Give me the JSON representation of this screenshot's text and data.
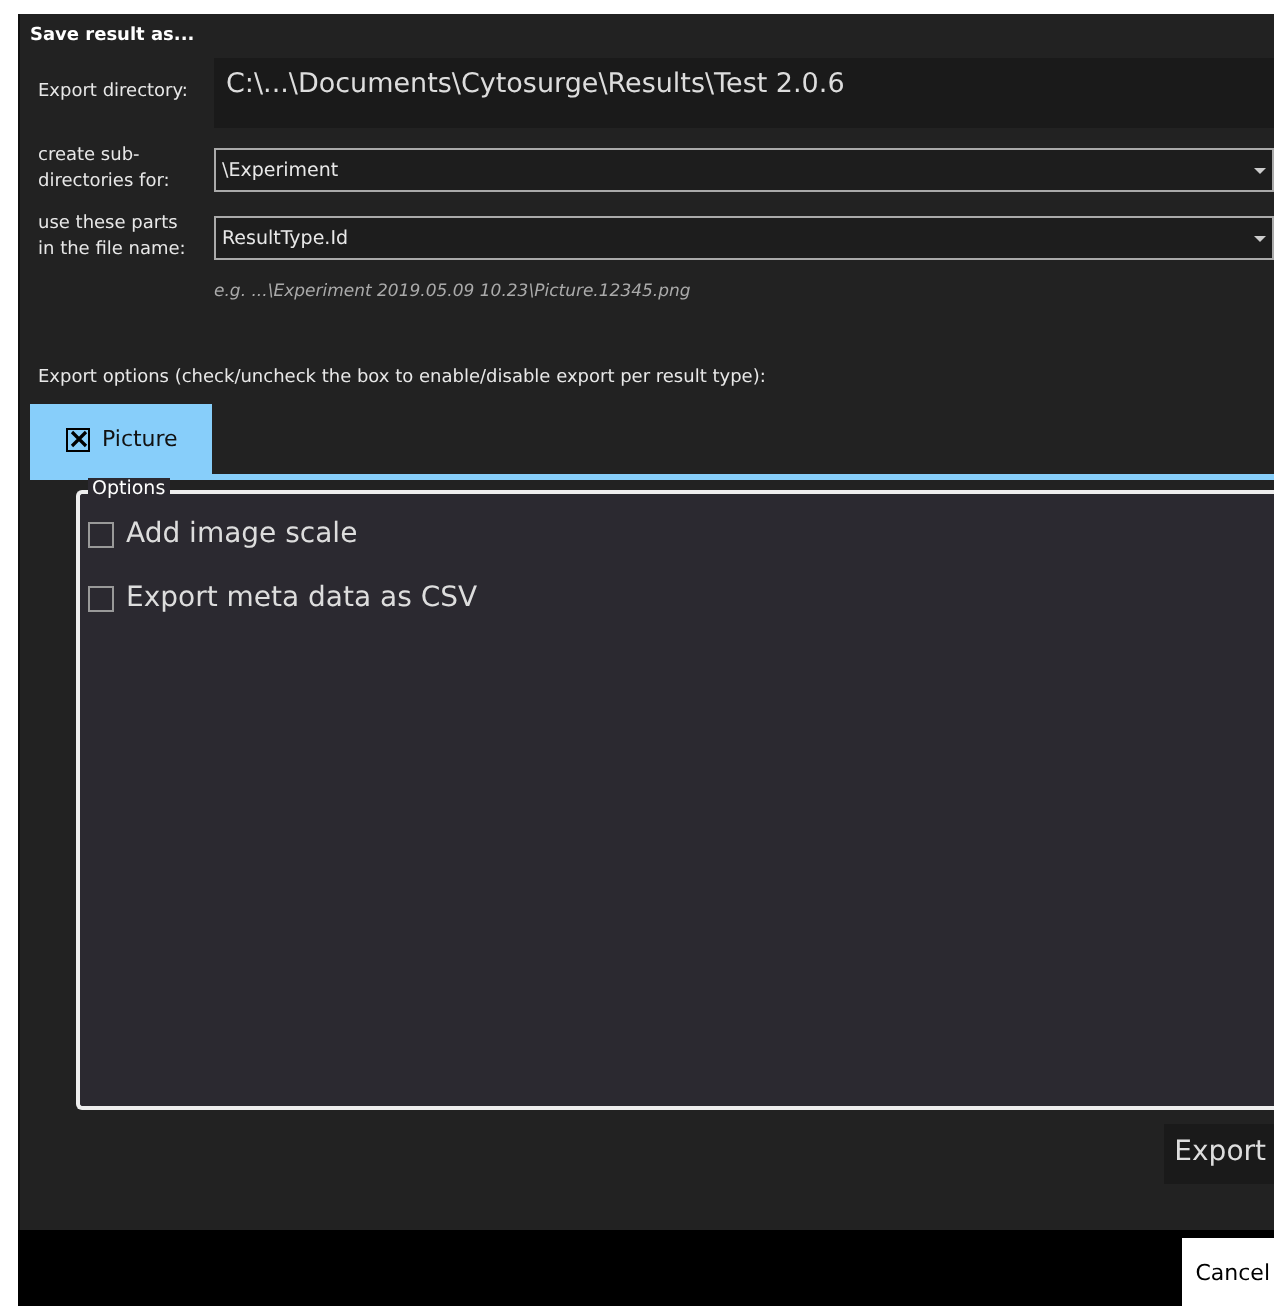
{
  "dialog": {
    "title": "Save result as...",
    "export_directory": {
      "label": "Export directory:",
      "value": "C:\\...\\Documents\\Cytosurge\\Results\\Test 2.0.6"
    },
    "subdirectories": {
      "label": "create sub-\ndirectories for:",
      "value": "\\Experiment"
    },
    "file_name_parts": {
      "label": "use these parts\nin the file name:",
      "value": "ResultType.Id"
    },
    "example": "e.g. ...\\Experiment 2019.05.09 10.23\\Picture.12345.png",
    "export_options_label": "Export options (check/uncheck the box to enable/disable export per result type):",
    "tabs": [
      {
        "label": "Picture",
        "selected": true,
        "checked": true
      }
    ],
    "options_group": {
      "title": "Options",
      "items": [
        {
          "label": "Add image scale",
          "checked": false
        },
        {
          "label": "Export meta data as CSV",
          "checked": false
        }
      ]
    },
    "buttons": [
      {
        "label": "Export"
      }
    ]
  },
  "cancel_button": {
    "label": "Cancel"
  }
}
